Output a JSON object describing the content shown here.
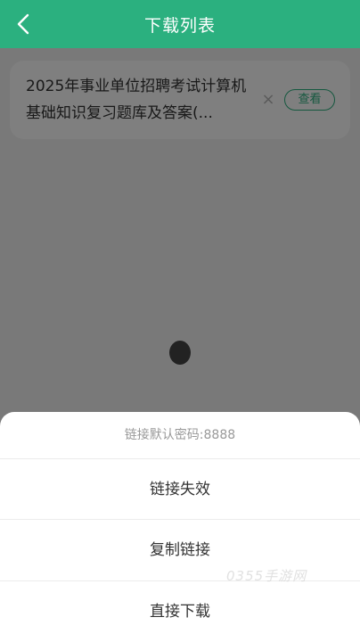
{
  "header": {
    "title": "下载列表",
    "back_icon": "chevron-left-icon",
    "background_color": "#2bb07f"
  },
  "download_list": {
    "items": [
      {
        "title": "2025年事业单位招聘考试计算机基础知识复习题库及答案(...",
        "close_icon": "close-icon",
        "view_label": "查看"
      }
    ]
  },
  "loading_indicator": "loading-icon",
  "action_sheet": {
    "hint": "链接默认密码:8888",
    "options": [
      {
        "label": "链接失效"
      },
      {
        "label": "复制链接"
      },
      {
        "label": "直接下载"
      }
    ]
  },
  "watermark": "0355手游网",
  "accent_color": "#2bb07f"
}
